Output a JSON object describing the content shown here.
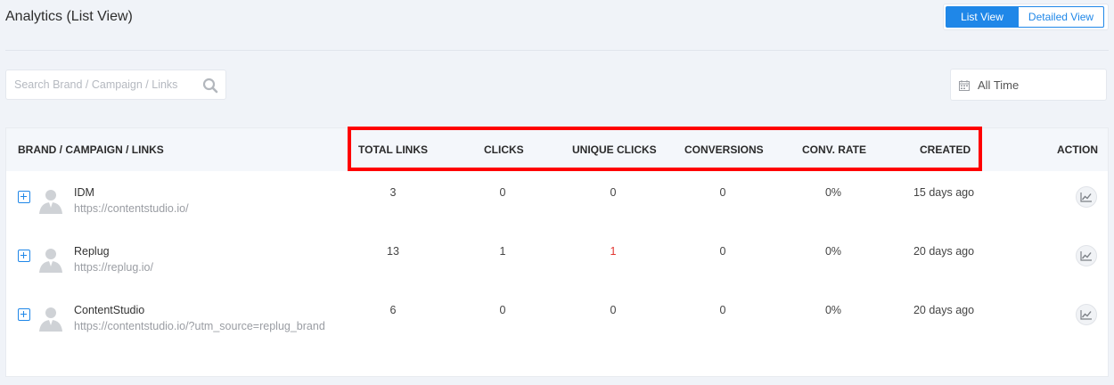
{
  "header": {
    "title": "Analytics (List View)",
    "views": [
      {
        "label": "List View",
        "active": true
      },
      {
        "label": "Detailed View",
        "active": false
      }
    ]
  },
  "filters": {
    "search_placeholder": "Search Brand / Campaign / Links",
    "date_range": "All Time"
  },
  "table": {
    "columns": {
      "brand": "BRAND / CAMPAIGN / LINKS",
      "total_links": "TOTAL LINKS",
      "clicks": "CLICKS",
      "unique_clicks": "UNIQUE CLICKS",
      "conversions": "CONVERSIONS",
      "conv_rate": "CONV. RATE",
      "created": "CREATED",
      "action": "ACTION"
    },
    "rows": [
      {
        "name": "IDM",
        "url": "https://contentstudio.io/",
        "total_links": "3",
        "clicks": "0",
        "unique_clicks": "0",
        "conversions": "0",
        "conv_rate": "0%",
        "created": "15 days ago"
      },
      {
        "name": "Replug",
        "url": "https://replug.io/",
        "total_links": "13",
        "clicks": "1",
        "unique_clicks": "1",
        "conversions": "0",
        "conv_rate": "0%",
        "created": "20 days ago"
      },
      {
        "name": "ContentStudio",
        "url": "https://contentstudio.io/?utm_source=replug_brand",
        "total_links": "6",
        "clicks": "0",
        "unique_clicks": "0",
        "conversions": "0",
        "conv_rate": "0%",
        "created": "20 days ago"
      }
    ]
  },
  "icons": {
    "search": "search-icon",
    "calendar": "calendar-icon",
    "expand": "plus-square-icon",
    "avatar": "user-avatar-icon",
    "action": "line-chart-icon"
  },
  "colors": {
    "accent": "#1f87e8",
    "highlight": "#ff0000",
    "unique_clicks_positive": "#e2342f"
  }
}
